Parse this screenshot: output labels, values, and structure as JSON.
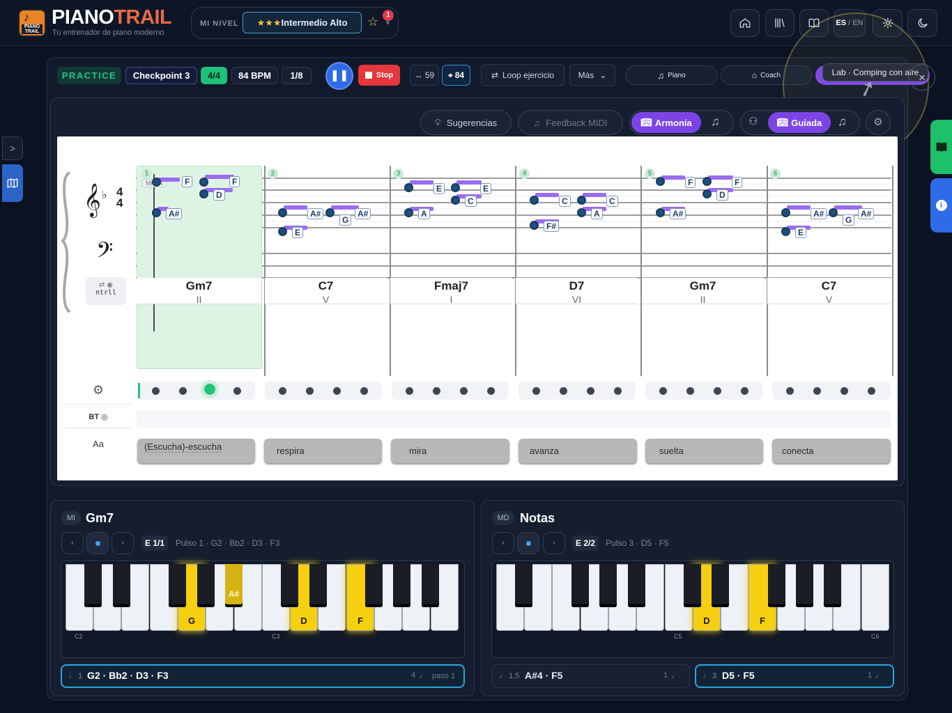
{
  "brand": {
    "name_a": "PIANO",
    "name_b": "TRAIL",
    "tagline": "Tu entrenador de piano moderno",
    "logo_text": "PIANO TRAIL"
  },
  "level": {
    "label": "MI NIVEL",
    "stars": "★★★",
    "value": "Intermedio Alto",
    "badge": "1"
  },
  "top_nav": {
    "lang_es": "ES",
    "lang_sep": " / ",
    "lang_en": "EN"
  },
  "toolbar": {
    "mode": "PRACTICE",
    "checkpoint": "Checkpoint 3",
    "meter": "4/4",
    "bpm": "84 BPM",
    "subdivision": "1/8",
    "stop": "Stop",
    "range_value": "59",
    "target_value": "84",
    "loop": "Loop ejercicio",
    "more": "Más",
    "piano": "Piano",
    "coach": "Coach",
    "lab_tooltip": "Lab · Comping con aire"
  },
  "score_tabs": {
    "suggestions": "Sugerencias",
    "midi": "Feedback MIDI",
    "harmony": "Armonía",
    "guided": "Guiada"
  },
  "staff": {
    "key_sign": "♭",
    "time_top": "4",
    "time_bottom": "4",
    "ctrl_label": "ntrll",
    "ctrl_icon": "⇄ ◉",
    "measure_overlay": "Mi  04"
  },
  "measures": [
    {
      "num": "1",
      "chord": "Gm7",
      "roman": "II",
      "lyric": "(Escucha)-escucha"
    },
    {
      "num": "2",
      "chord": "C7",
      "roman": "V",
      "lyric": "respira"
    },
    {
      "num": "3",
      "chord": "Fmaj7",
      "roman": "I",
      "lyric": "mira"
    },
    {
      "num": "4",
      "chord": "D7",
      "roman": "VI",
      "lyric": "avanza"
    },
    {
      "num": "5",
      "chord": "Gm7",
      "roman": "II",
      "lyric": "suelta"
    },
    {
      "num": "6",
      "chord": "C7",
      "roman": "V",
      "lyric": "conecta"
    }
  ],
  "row_labels": {
    "bt": "BT ◎",
    "aa": "Aa"
  },
  "left_panel": {
    "hand": "MI",
    "title": "Gm7",
    "step": "E 1/1",
    "info": "Pulso 1 · G2 · Bb2 · D3 · F3",
    "octave_a": "C2",
    "octave_b": "C3",
    "key_g": "G",
    "key_as": "A#",
    "key_d": "D",
    "key_f": "F",
    "footer_num": "1",
    "footer_notes": "G2 · Bb2 · D3 · F3",
    "footer_right": "4",
    "footer_step": "paso 1"
  },
  "right_panel": {
    "hand": "MD",
    "title": "Notas",
    "step": "E 2/2",
    "info": "Pulso 3 · D5 · F5",
    "octave_a": "C5",
    "octave_b": "C6",
    "key_d": "D",
    "key_f": "F",
    "card1_num": "1.5",
    "card1_notes": "A#4 · F5",
    "card1_right": "1",
    "card2_num": "3",
    "card2_notes": "D5 · F5",
    "card2_right": "1"
  },
  "colors": {
    "accent": "#8b5cf6",
    "green": "#25c27a",
    "stop": "#e5373c",
    "play": "#2f6be8",
    "highlight": "#f6cf0f"
  }
}
